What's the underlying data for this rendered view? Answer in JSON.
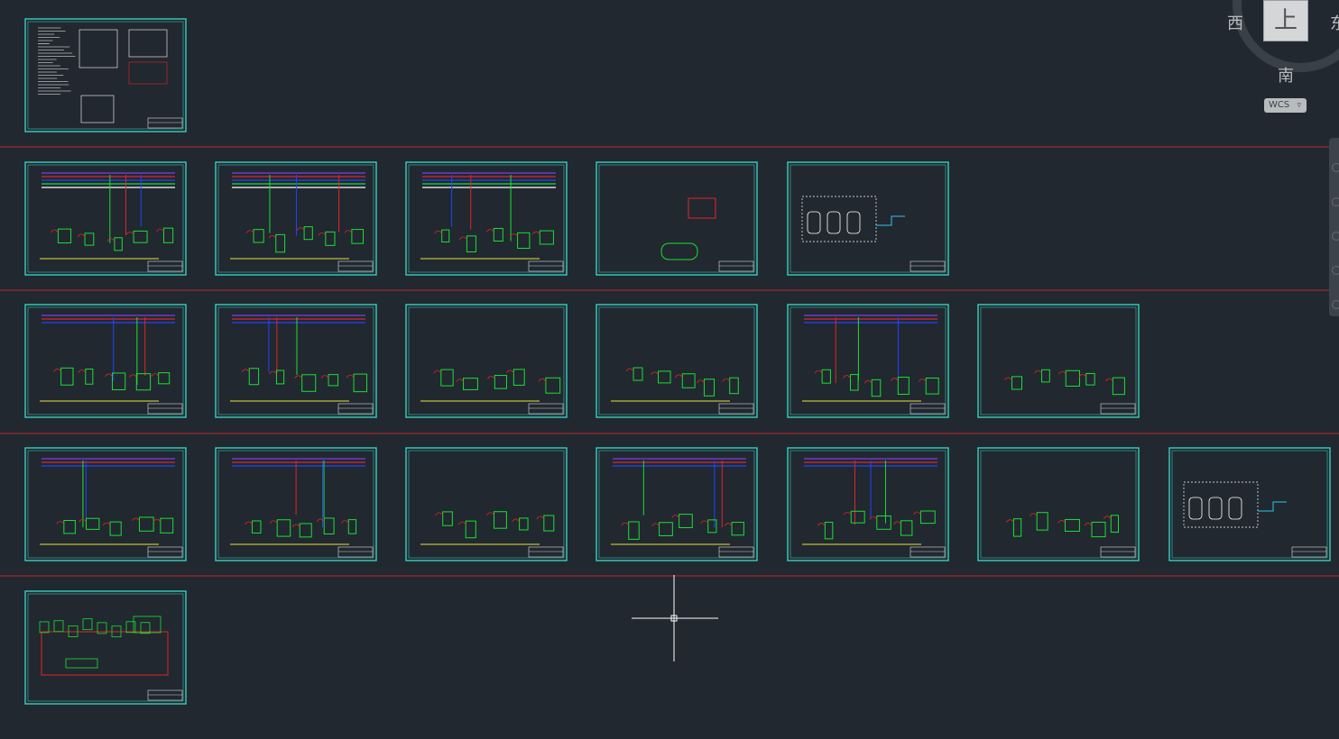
{
  "viewcube": {
    "face_top": "上",
    "west": "西",
    "east": "东",
    "south": "南",
    "wcs_label": "WCS",
    "wcs_chevron": "chevron-down-icon"
  },
  "colors": {
    "background": "#212830",
    "sheet_border": "#37c4b6",
    "divider": "#c0262b",
    "pipe_green": "#19e032",
    "pipe_yellow": "#e7e33a",
    "pipe_purple": "#7b3df0",
    "pipe_red": "#e02626",
    "pipe_blue": "#2146ff",
    "pipe_cyan": "#29c7e6",
    "crosshair": "#ffffff"
  },
  "drawing_rows": [
    {
      "row": 1,
      "sheets": [
        "cover"
      ]
    },
    {
      "row": 2,
      "sheets": [
        "process-a",
        "process-b",
        "process-c",
        "vessel",
        "evaporator"
      ]
    },
    {
      "row": 3,
      "sheets": [
        "piping-1",
        "piping-2",
        "piping-3",
        "piping-4",
        "piping-5",
        "piping-6"
      ]
    },
    {
      "row": 4,
      "sheets": [
        "piping-7",
        "piping-8",
        "piping-9",
        "piping-10",
        "piping-11",
        "piping-12",
        "evaporator-2"
      ]
    },
    {
      "row": 5,
      "sheets": [
        "overview"
      ]
    }
  ]
}
